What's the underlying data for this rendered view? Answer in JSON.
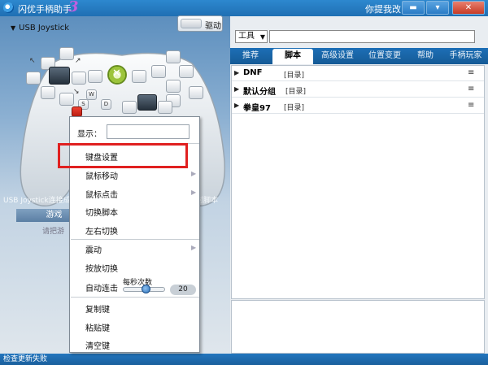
{
  "window": {
    "title": "闪优手柄助手",
    "version": "3",
    "feedback": "你提我改",
    "minimize": "▬",
    "maximize": "▾",
    "close": "✕"
  },
  "left": {
    "device": "USB Joystick",
    "driver_button": "驱动",
    "status_text": "USB Joystick连接成功",
    "status_text_right": "射脚本",
    "tab_label": "游戏",
    "hint": "请把游"
  },
  "gamepad": {
    "key_w": "W",
    "key_s": "S",
    "key_d": "D",
    "red_key": "■"
  },
  "right": {
    "tools_label": "工具",
    "tabs": [
      "推荐",
      "脚本",
      "高级设置",
      "位置变更",
      "帮助",
      "手柄玩家"
    ],
    "active_tab": "脚本",
    "scripts": [
      {
        "name": "DNF",
        "tag": "[目录]"
      },
      {
        "name": "默认分组",
        "tag": "[目录]"
      },
      {
        "name": "拳皇97",
        "tag": "[目录]"
      }
    ]
  },
  "statusbar": {
    "text": "检查更新失败"
  },
  "context_menu": {
    "display_label": "显示：",
    "display_value": "",
    "items": {
      "keyboard": "键盘设置",
      "mouse_move": "鼠标移动",
      "mouse_click": "鼠标点击",
      "switch_script": "切换脚本",
      "switch_lr": "左右切换",
      "vibrate": "震动",
      "hold_switch": "按放切换",
      "autofire": "自动连击",
      "copy": "复制键",
      "paste": "粘贴键",
      "clear": "清空键"
    },
    "autofire_rate_label": "每秒次数",
    "autofire_rate_value": "20",
    "autofire_rate_fraction": 0.55
  },
  "colors": {
    "titlebar": "#1f6fb3",
    "highlight": "#e02020",
    "tab_bar": "#1d6fb6"
  }
}
